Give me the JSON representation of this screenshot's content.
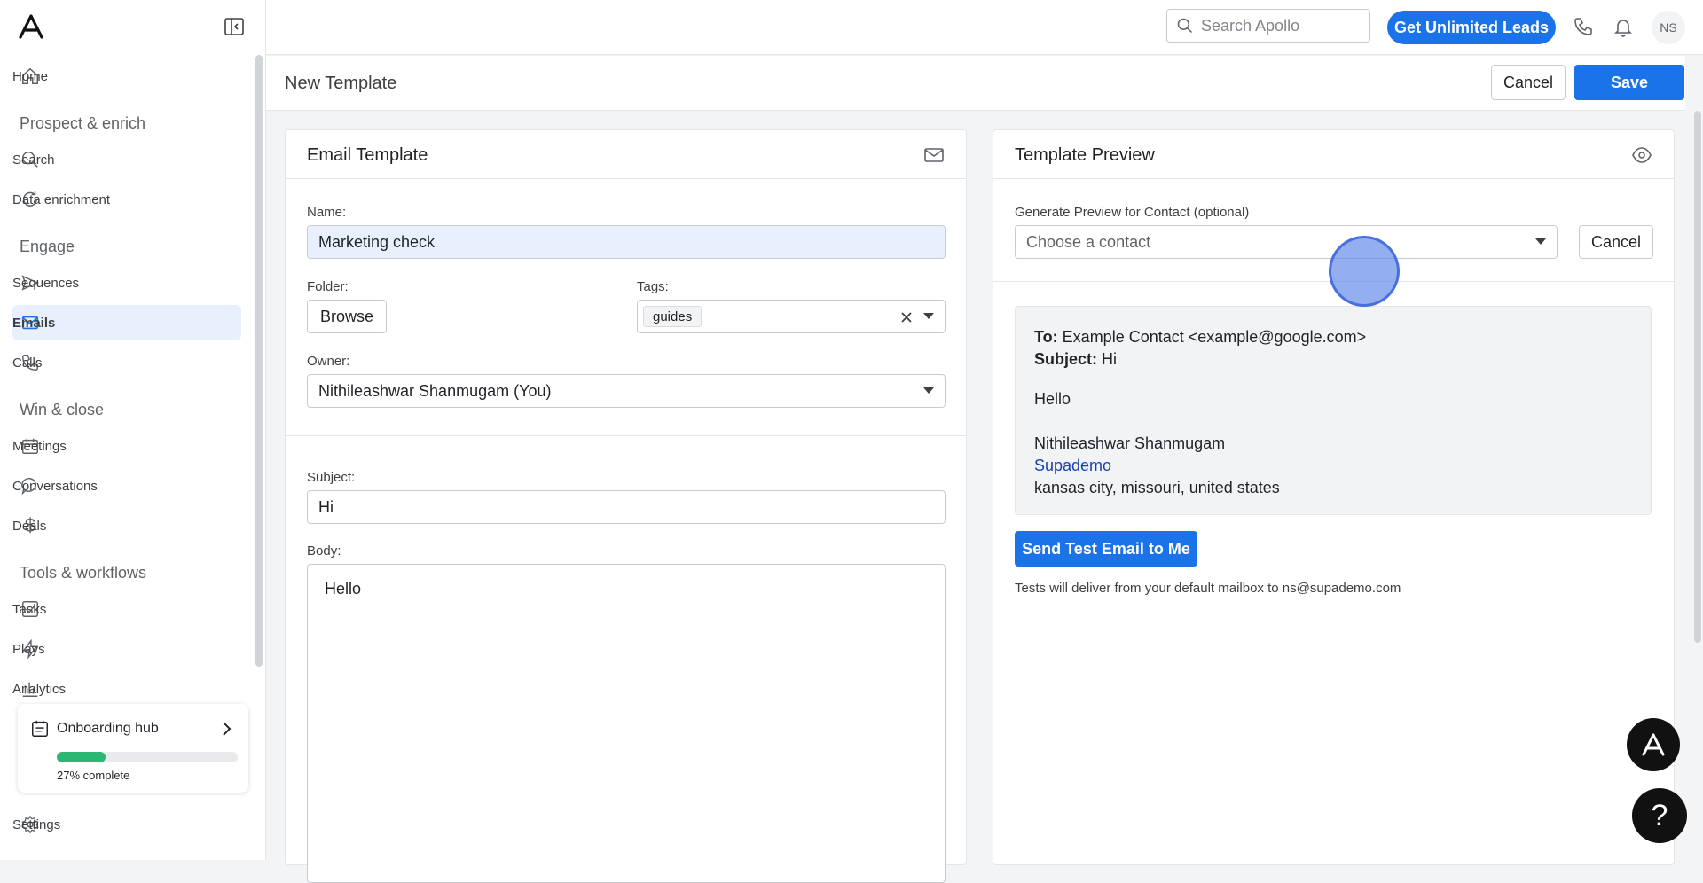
{
  "sidebar": {
    "nav": {
      "home": "Home",
      "section_prospect": "Prospect & enrich",
      "search": "Search",
      "data_enrichment": "Data enrichment",
      "section_engage": "Engage",
      "sequences": "Sequences",
      "emails": "Emails",
      "calls": "Calls",
      "section_win": "Win & close",
      "meetings": "Meetings",
      "conversations": "Conversations",
      "deals": "Deals",
      "section_tools": "Tools & workflows",
      "tasks": "Tasks",
      "plays": "Plays",
      "analytics": "Analytics"
    },
    "onboarding": {
      "title": "Onboarding hub",
      "progress": 0.27,
      "progress_label": "27% complete"
    },
    "settings": "Settings"
  },
  "topbar": {
    "search_placeholder": "Search Apollo",
    "cta": "Get Unlimited Leads",
    "avatar_initials": "NS"
  },
  "page": {
    "title": "New Template",
    "cancel": "Cancel",
    "save": "Save"
  },
  "email_template": {
    "title": "Email Template",
    "name_label": "Name:",
    "name_value": "Marketing check",
    "folder_label": "Folder:",
    "folder_button": "Browse",
    "tags_label": "Tags:",
    "tag": "guides",
    "owner_label": "Owner:",
    "owner_value": "Nithileashwar Shanmugam (You)",
    "subject_label": "Subject:",
    "subject_value": "Hi",
    "body_label": "Body:",
    "body_value": "Hello"
  },
  "template_preview": {
    "title": "Template Preview",
    "contact_label": "Generate Preview for Contact (optional)",
    "contact_placeholder": "Choose a contact",
    "cancel": "Cancel",
    "to_label": "To:",
    "to_value": "Example Contact <example@google.com>",
    "subject_label": "Subject:",
    "subject_value": "Hi",
    "greeting": "Hello",
    "sig_name": "Nithileashwar Shanmugam",
    "sig_company": "Supademo",
    "sig_location": "kansas city, missouri, united states",
    "send_test": "Send Test Email to Me",
    "test_note": "Tests will deliver from your default mailbox to ns@supademo.com"
  },
  "help": {
    "label": "?"
  },
  "colors": {
    "primary": "#1a73e8",
    "progress": "#2bb673",
    "active_nav": "#e8f0fe"
  }
}
